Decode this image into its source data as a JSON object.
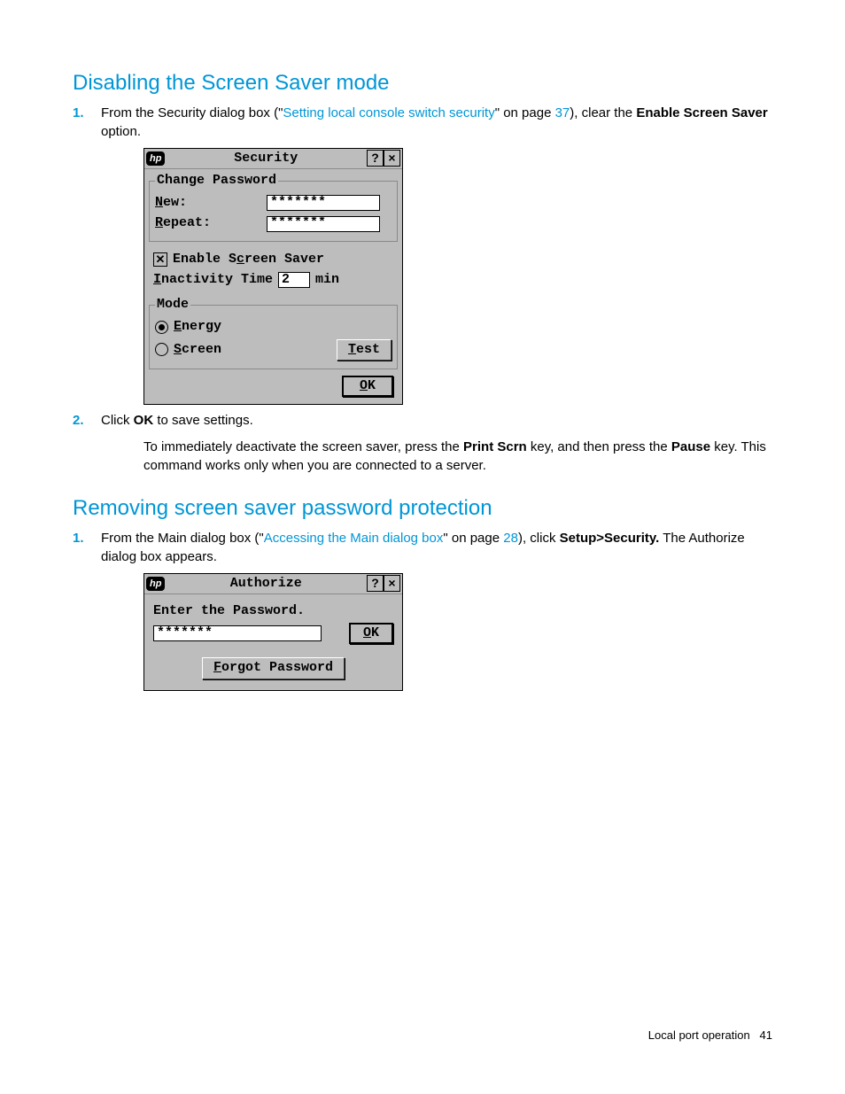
{
  "section1": {
    "title": "Disabling the Screen Saver mode",
    "step1_num": "1.",
    "step1_a": "From the Security dialog box (\"",
    "step1_link": "Setting local console switch security",
    "step1_b": "\" on page ",
    "step1_page": "37",
    "step1_c": "), clear the ",
    "step1_bold": "Enable Screen Saver",
    "step1_d": " option.",
    "step2_num": "2.",
    "step2_a": "Click ",
    "step2_bold": "OK",
    "step2_b": " to save settings.",
    "para_a": "To immediately deactivate the screen saver, press the ",
    "para_bold1": "Print Scrn",
    "para_b": " key, and then press the ",
    "para_bold2": "Pause",
    "para_c": " key. This command works only when you are connected to a server."
  },
  "security_dialog": {
    "logo": "hp",
    "title": "Security",
    "help": "?",
    "close": "×",
    "group1_legend": "Change Password",
    "new_u": "N",
    "new_rest": "ew:",
    "repeat_u": "R",
    "repeat_rest": "epeat:",
    "pwd_mask": "*******",
    "chk_mark": "⊠",
    "enable_a": "Enable S",
    "enable_u": "c",
    "enable_b": "reen Saver",
    "inact_u": "I",
    "inact_rest": "nactivity Time",
    "inact_val": "2",
    "inact_unit": "min",
    "mode_legend": "Mode",
    "energy_u": "E",
    "energy_rest": "nergy",
    "screen_u": "S",
    "screen_rest": "creen",
    "test_u": "T",
    "test_rest": "est",
    "ok_u": "O",
    "ok_rest": "K"
  },
  "section2": {
    "title": "Removing screen saver password protection",
    "step1_num": "1.",
    "step1_a": "From the Main dialog box (\"",
    "step1_link": "Accessing the Main dialog box",
    "step1_b": "\" on page ",
    "step1_page": "28",
    "step1_c": "), click ",
    "step1_bold": "Setup>Security.",
    "step1_d": " The Authorize dialog box appears."
  },
  "authorize_dialog": {
    "logo": "hp",
    "title": "Authorize",
    "help": "?",
    "close": "×",
    "prompt": "Enter the Password.",
    "pwd_mask": "*******",
    "ok_u": "O",
    "ok_rest": "K",
    "forgot_u": "F",
    "forgot_rest": "orgot Password"
  },
  "footer": {
    "section": "Local port operation",
    "page": "41"
  }
}
